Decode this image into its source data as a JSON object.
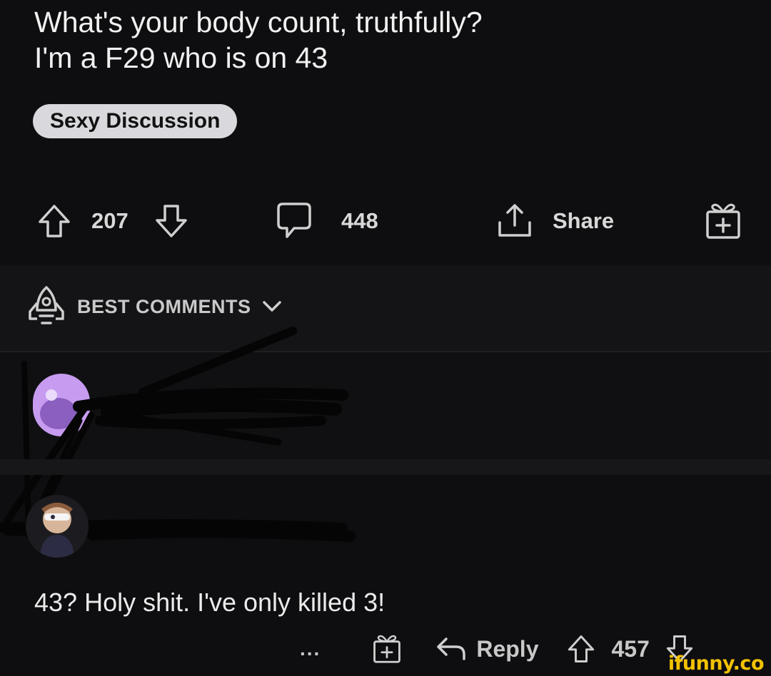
{
  "post": {
    "title_line1": "What's your body count, truthfully?",
    "title_line2": "I'm a F29 who is on 43",
    "flair": "Sexy Discussion"
  },
  "actions": {
    "upvotes": "207",
    "comments": "448",
    "share_label": "Share"
  },
  "sort": {
    "label": "BEST COMMENTS"
  },
  "comment": {
    "body": "43? Holy shit. I've only killed 3!",
    "more": "...",
    "reply_label": "Reply",
    "votes": "457"
  },
  "watermark": "ifunny.co",
  "colors": {
    "background": "#0e0e10",
    "flair_bg": "#d9d9dd",
    "avatar_purple": "#c79cf0",
    "watermark": "#f2c200"
  }
}
